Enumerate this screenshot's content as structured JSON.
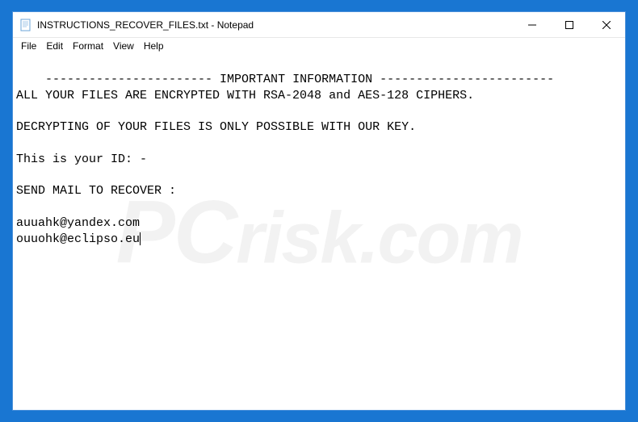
{
  "titlebar": {
    "filename": "INSTRUCTIONS_RECOVER_FILES.txt",
    "appname": "Notepad"
  },
  "menu": {
    "file": "File",
    "edit": "Edit",
    "format": "Format",
    "view": "View",
    "help": "Help"
  },
  "content": {
    "line1": "----------------------- IMPORTANT INFORMATION ------------------------",
    "line2": "ALL YOUR FILES ARE ENCRYPTED WITH RSA-2048 and AES-128 CIPHERS.",
    "line3": "",
    "line4": "DECRYPTING OF YOUR FILES IS ONLY POSSIBLE WITH OUR KEY.",
    "line5": "",
    "line6": "This is your ID: -",
    "line7": "",
    "line8": "SEND MAIL TO RECOVER :",
    "line9": "",
    "line10": "auuahk@yandex.com",
    "line11": "ouuohk@eclipso.eu"
  },
  "watermark": {
    "pc": "PC",
    "rest": "risk.com"
  }
}
